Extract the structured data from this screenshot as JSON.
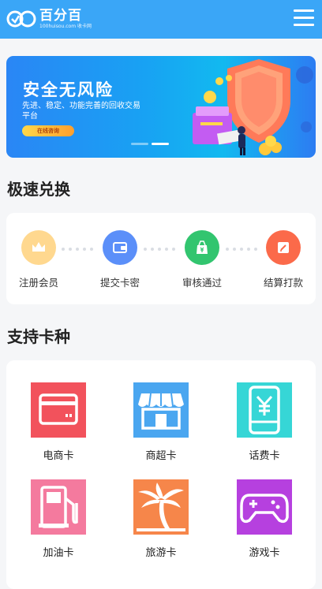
{
  "header": {
    "brand_name": "百分百",
    "brand_sub": "100huisou.com 收卡网",
    "menu_icon": "hamburger-icon"
  },
  "banner": {
    "title": "安全无风险",
    "subtitle": "先进、稳定、功能完善的回收交易平台",
    "button_label": "在线咨询",
    "slides_total": 2,
    "active_slide": 2
  },
  "exchange": {
    "title": "极速兑换",
    "steps": [
      {
        "label": "注册会员",
        "icon": "crown-icon",
        "color": "#ffd88f"
      },
      {
        "label": "提交卡密",
        "icon": "card-wallet-icon",
        "color": "#5b8ff9"
      },
      {
        "label": "审核通过",
        "icon": "money-bag-icon",
        "color": "#32c56f"
      },
      {
        "label": "结算打款",
        "icon": "pencil-note-icon",
        "color": "#fb6a4a"
      }
    ]
  },
  "card_types": {
    "title": "支持卡种",
    "items": [
      {
        "label": "电商卡",
        "icon": "credit-card-icon",
        "color": "#f2525c"
      },
      {
        "label": "商超卡",
        "icon": "store-icon",
        "color": "#4aa6f0"
      },
      {
        "label": "话费卡",
        "icon": "phone-yuan-icon",
        "color": "#36d6d6"
      },
      {
        "label": "加油卡",
        "icon": "fuel-pump-icon",
        "color": "#f47a9e"
      },
      {
        "label": "旅游卡",
        "icon": "palm-tree-icon",
        "color": "#f6864a"
      },
      {
        "label": "游戏卡",
        "icon": "gamepad-icon",
        "color": "#b640df"
      }
    ]
  }
}
